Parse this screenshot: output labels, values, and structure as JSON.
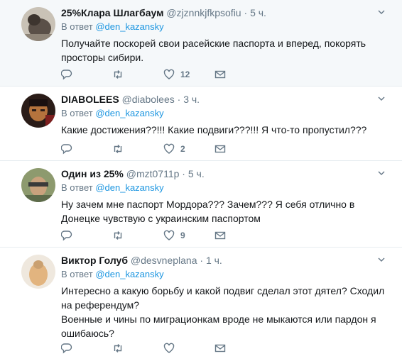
{
  "reply_prefix": "В ответ",
  "tweets": [
    {
      "name": "25%Клара Шлагбаум",
      "handle": "@zjznnkjfkpsofiu",
      "time": "5 ч.",
      "reply_to": "@den_kazansky",
      "text": [
        "Получайте поскорей свои расейские паспорта и вперед, покорять просторы сибири."
      ],
      "likes": "12"
    },
    {
      "name": "DIABOLEES",
      "handle": "@diabolees",
      "time": "3 ч.",
      "reply_to": "@den_kazansky",
      "text": [
        "Какие достижения??!!! Какие подвиги???!!! Я что-то пропустил???"
      ],
      "likes": "2"
    },
    {
      "name": "Один из 25%",
      "handle": "@mzt0711p",
      "time": "5 ч.",
      "reply_to": "@den_kazansky",
      "text": [
        "Ну зачем мне паспорт Мордора??? Зачем??? Я себя отлично в Донецке чувствую с украинским паспортом"
      ],
      "likes": "9"
    },
    {
      "name": "Виктор Голуб",
      "handle": "@desvneplana",
      "time": "1 ч.",
      "reply_to": "@den_kazansky",
      "text": [
        "Интересно а какую борьбу и какой подвиг сделал этот дятел? Сходил на референдум?",
        "Военные и чины по миграционкам вроде не мыкаются или пардон я ошибаюсь?"
      ],
      "likes": ""
    }
  ],
  "colors": {
    "link": "#1b95e0",
    "muted": "#657786",
    "divider": "#e6ecf0",
    "highlight_bg": "#f5f8fa"
  }
}
